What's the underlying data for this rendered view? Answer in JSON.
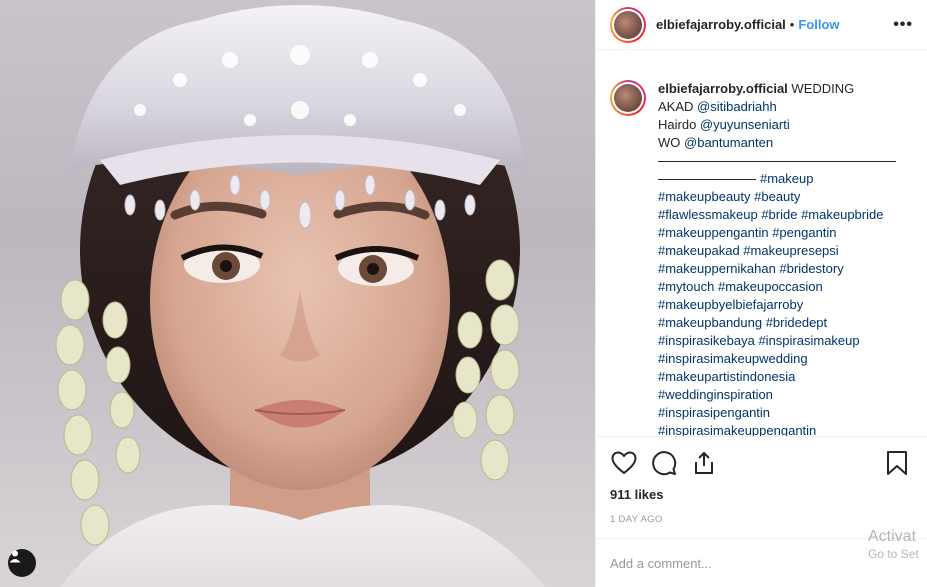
{
  "post": {
    "image_alt": "",
    "user_tag_icon": "person-icon"
  },
  "header": {
    "username": "elbiefajarroby.official",
    "separator": "•",
    "follow_label": "Follow",
    "more_icon": "more-options-icon",
    "more_label": "•••"
  },
  "caption": {
    "username": "elbiefajarroby.official",
    "title": "WEDDING",
    "akad_prefix": "AKAD",
    "akad_mention": "@sitibadriahh",
    "hairdo_prefix": "Hairdo",
    "hairdo_mention": "@yuyunseniarti",
    "wo_prefix": "WO",
    "wo_mention": "@bantumanten",
    "hashtag_lines": [
      "#makeup",
      "#makeupbeauty #beauty",
      "#flawlessmakeup #bride #makeupbride",
      "#makeuppengantin #pengantin",
      "#makeupakad #makeupresepsi",
      "#makeuppernikahan #bridestory",
      "#mytouch #makeupoccasion",
      "#makeupbyelbiefajarroby",
      "#makeupbandung #bridedept",
      "#inspirasikebaya #inspirasimakeup",
      "#inspirasimakeupwedding",
      "#makeupartistindonesia",
      "#weddinginspiration",
      "#inspirasipengantin",
      "#inspirasimakeuppengantin"
    ]
  },
  "actions": {
    "like_icon": "heart-icon",
    "comment_icon": "comment-icon",
    "share_icon": "share-icon",
    "save_icon": "bookmark-icon",
    "likes": "911 likes",
    "time": "1 DAY AGO"
  },
  "comment": {
    "placeholder": "Add a comment..."
  },
  "watermark": {
    "line1": "Activat",
    "line2": "Go to Set"
  },
  "colors": {
    "follow": "#3897f0",
    "link": "#003569",
    "text": "#262626",
    "muted": "#999999",
    "border": "#efefef"
  }
}
